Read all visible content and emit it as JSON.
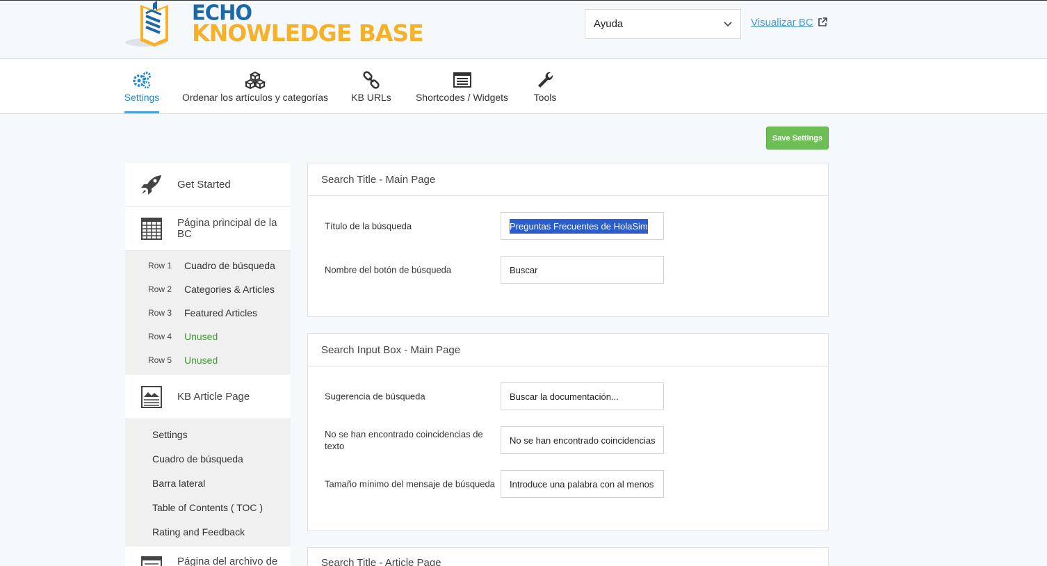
{
  "header": {
    "logo_line1": "ECHO",
    "logo_line2": "KNOWLEDGE BASE",
    "help_select_value": "Ayuda",
    "view_link": "Visualizar BC"
  },
  "tabs": [
    {
      "label": "Settings",
      "icon": "gears-icon",
      "active": true
    },
    {
      "label": "Ordenar los artículos y categorías",
      "icon": "cubes-icon"
    },
    {
      "label": "KB URLs",
      "icon": "link-icon"
    },
    {
      "label": "Shortcodes / Widgets",
      "icon": "list-window-icon"
    },
    {
      "label": "Tools",
      "icon": "wrench-icon"
    }
  ],
  "save_button": "Save Settings",
  "sidebar": {
    "get_started": "Get Started",
    "main_page": "Página principal de la BC",
    "rows": [
      {
        "num": "Row 1",
        "name": "Cuadro de búsqueda",
        "unused": false
      },
      {
        "num": "Row 2",
        "name": "Categories & Articles",
        "unused": false
      },
      {
        "num": "Row 3",
        "name": "Featured Articles",
        "unused": false
      },
      {
        "num": "Row 4",
        "name": "Unused",
        "unused": true
      },
      {
        "num": "Row 5",
        "name": "Unused",
        "unused": true
      }
    ],
    "article_page": "KB Article Page",
    "article_items": [
      "Settings",
      "Cuadro de búsqueda",
      "Barra lateral",
      "Table of Contents ( TOC )",
      "Rating and Feedback"
    ],
    "archive_page": "Página del archivo de"
  },
  "panels": {
    "search_title_main": {
      "title": "Search Title - Main Page",
      "fields": [
        {
          "label": "Título de la búsqueda",
          "value": "Preguntas Frecuentes de HolaSim"
        },
        {
          "label": "Nombre del botón de búsqueda",
          "value": "Buscar"
        }
      ]
    },
    "search_input_main": {
      "title": "Search Input Box - Main Page",
      "fields": [
        {
          "label": "Sugerencia de búsqueda",
          "value": "Buscar la documentación..."
        },
        {
          "label": "No se han encontrado coincidencias de texto",
          "value": "No se han encontrado coincidencias"
        },
        {
          "label": "Tamaño mínimo del mensaje de búsqueda",
          "value": "Introduce una palabra con al menos"
        }
      ]
    },
    "search_title_article": {
      "title": "Search Title - Article Page"
    }
  },
  "colors": {
    "accent": "#1e88d0",
    "save_green": "#6ebe56",
    "unused_green": "#3d9a2f",
    "selection": "#2b5dcd"
  }
}
